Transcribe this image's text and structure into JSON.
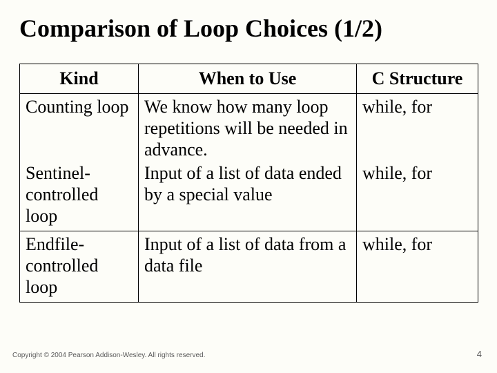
{
  "title": "Comparison of Loop Choices (1/2)",
  "table": {
    "headers": {
      "kind": "Kind",
      "when": "When to Use",
      "cstruct": "C Structure"
    },
    "rows": [
      {
        "kind": "Counting loop",
        "when": "We know how many loop repetitions will be needed in advance.",
        "cstruct": "while, for"
      },
      {
        "kind": "Sentinel-controlled loop",
        "when": "Input of a list of data ended by a special value",
        "cstruct": "while, for"
      },
      {
        "kind": "Endfile-controlled loop",
        "when": "Input of a list of data from a data file",
        "cstruct": "while, for"
      }
    ]
  },
  "footer": {
    "copyright": "Copyright © 2004 Pearson Addison-Wesley. All rights reserved.",
    "page": "4"
  }
}
